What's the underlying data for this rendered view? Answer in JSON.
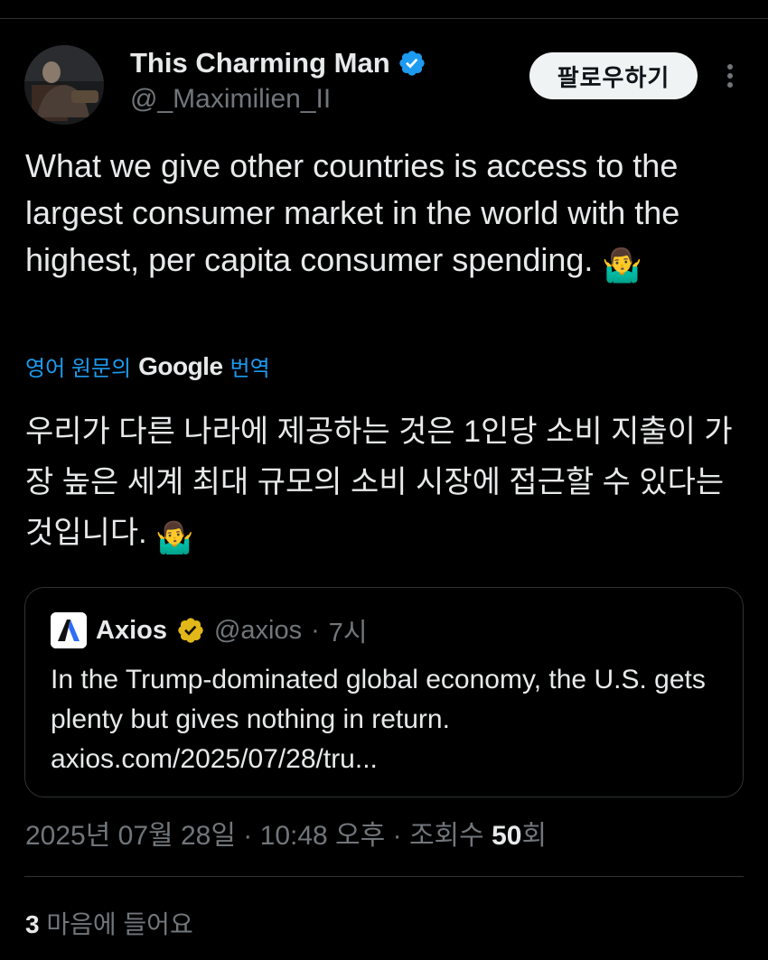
{
  "author": {
    "display_name": "This Charming Man",
    "handle": "@_Maximilien_II",
    "avatar_icon": "profile-photo",
    "verified_color": "#1d9bf0"
  },
  "follow_button": {
    "label": "팔로우하기"
  },
  "more_icon": "more-vertical-icon",
  "tweet": {
    "text": "What we give other countries is access to the largest consumer market in the world with the highest, per capita consumer spending.",
    "emoji": "🤷‍♂️"
  },
  "translation": {
    "prefix": "영어 원문의",
    "brand": "Google",
    "suffix": "번역",
    "text": "우리가 다른 나라에 제공하는 것은 1인당 소비 지출이 가장 높은 세계 최대 규모의 소비 시장에 접근할 수 있다는 것입니다.",
    "emoji": "🤷‍♂️",
    "link_color": "#1d9bf0"
  },
  "quote": {
    "name": "Axios",
    "handle": "@axios",
    "separator": "·",
    "time": "7시",
    "text": "In the Trump-dominated global economy, the U.S. gets plenty but gives nothing in return.",
    "link": "axios.com/2025/07/28/tru...",
    "badge_color": "#e2b719"
  },
  "meta": {
    "date": "2025년 07월 28일",
    "sep1": "·",
    "time": "10:48 오후",
    "sep2": "·",
    "views_label": "조회수",
    "views_count": "50",
    "views_suffix": "회"
  },
  "likes": {
    "count": "3",
    "label": "마음에 들어요"
  }
}
